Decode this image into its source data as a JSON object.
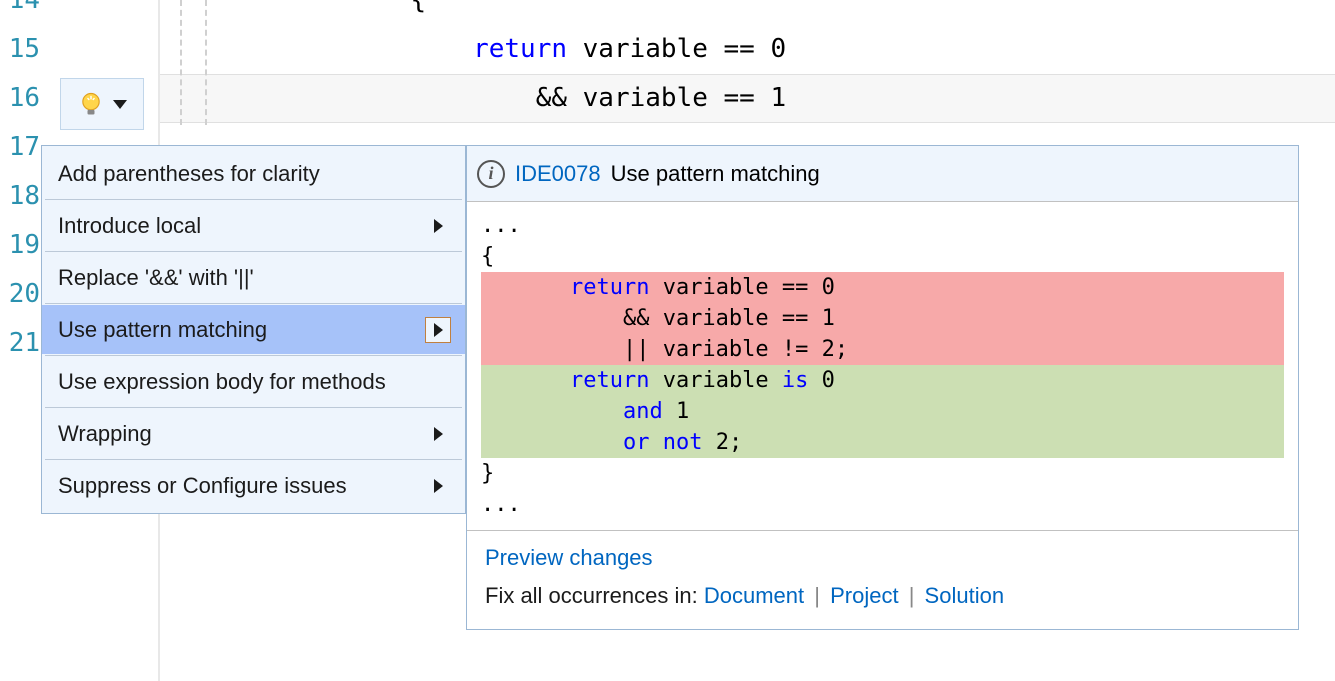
{
  "editor": {
    "line_numbers": [
      "14",
      "15",
      "16",
      "17",
      "18",
      "19",
      "20",
      "21"
    ],
    "code_lines": [
      {
        "indent": "                ",
        "tokens": [
          {
            "t": "{",
            "c": ""
          }
        ]
      },
      {
        "indent": "                    ",
        "tokens": [
          {
            "t": "return",
            "c": "kw"
          },
          {
            "t": " variable == 0",
            "c": ""
          }
        ]
      },
      {
        "indent": "                        ",
        "tokens": [
          {
            "t": "&& variable == 1",
            "c": ""
          }
        ]
      }
    ]
  },
  "menu": {
    "items": [
      {
        "label": "Add parentheses for clarity",
        "submenu": false,
        "selected": false,
        "sep_after": true
      },
      {
        "label": "Introduce local",
        "submenu": true,
        "selected": false,
        "sep_after": true
      },
      {
        "label": "Replace '&&' with '||'",
        "submenu": false,
        "selected": false,
        "sep_after": true
      },
      {
        "label": "Use pattern matching",
        "submenu": true,
        "selected": true,
        "sep_after": true
      },
      {
        "label": "Use expression body for methods",
        "submenu": false,
        "selected": false,
        "sep_after": true
      },
      {
        "label": "Wrapping",
        "submenu": true,
        "selected": false,
        "sep_after": true
      },
      {
        "label": "Suppress or Configure issues",
        "submenu": true,
        "selected": false,
        "sep_after": false
      }
    ]
  },
  "preview": {
    "rule_id": "IDE0078",
    "rule_title": "Use pattern matching",
    "pre_lines": [
      "...",
      "{"
    ],
    "del_lines": [
      [
        {
          "t": "    ",
          "c": ""
        },
        {
          "t": "return",
          "c": "kw2"
        },
        {
          "t": " variable == 0",
          "c": ""
        }
      ],
      [
        {
          "t": "        && variable == 1",
          "c": ""
        }
      ],
      [
        {
          "t": "        || variable != 2;",
          "c": ""
        }
      ]
    ],
    "add_lines": [
      [
        {
          "t": "    ",
          "c": ""
        },
        {
          "t": "return",
          "c": "kw2"
        },
        {
          "t": " variable ",
          "c": ""
        },
        {
          "t": "is",
          "c": "kw2"
        },
        {
          "t": " 0",
          "c": ""
        }
      ],
      [
        {
          "t": "        ",
          "c": ""
        },
        {
          "t": "and",
          "c": "kw2"
        },
        {
          "t": " 1",
          "c": ""
        }
      ],
      [
        {
          "t": "        ",
          "c": ""
        },
        {
          "t": "or not",
          "c": "kw2"
        },
        {
          "t": " 2;",
          "c": ""
        }
      ]
    ],
    "post_lines": [
      "}",
      "..."
    ],
    "footer": {
      "preview_label": "Preview changes",
      "fix_label": "Fix all occurrences in:",
      "links": [
        "Document",
        "Project",
        "Solution"
      ],
      "sep": "|"
    }
  }
}
